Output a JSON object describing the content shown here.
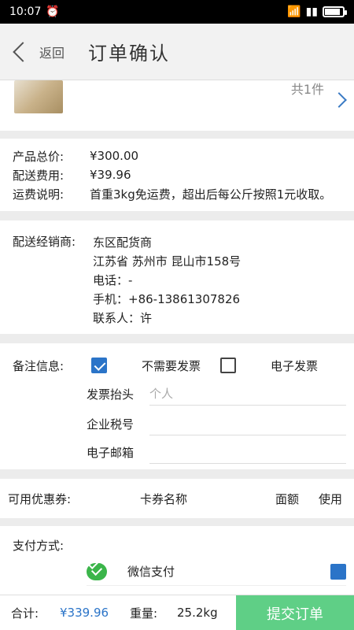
{
  "statusbar": {
    "time": "10:07"
  },
  "header": {
    "back_label": "返回",
    "title": "订单确认"
  },
  "product": {
    "count": "共1件"
  },
  "price": {
    "rows": [
      {
        "label": "产品总价:",
        "value": "¥300.00"
      },
      {
        "label": "配送费用:",
        "value": "¥39.96"
      },
      {
        "label": "运费说明:",
        "value": "首重3kg免运费，超出后每公斤按照1元收取。"
      }
    ]
  },
  "dealer": {
    "label": "配送经销商:",
    "lines": [
      "东区配货商",
      "江苏省 苏州市 昆山市158号",
      "电话：-",
      "手机：+86-13861307826",
      "联系人：许"
    ]
  },
  "remark": {
    "label": "备注信息:",
    "option1": "不需要发票",
    "option2": "电子发票",
    "invoice_title_label": "发票抬头",
    "invoice_title_placeholder": "个人",
    "tax_label": "企业税号",
    "email_label": "电子邮箱"
  },
  "coupon": {
    "label": "可用优惠券:",
    "col_name": "卡券名称",
    "col_amount": "面额",
    "col_use": "使用"
  },
  "payment": {
    "label": "支付方式:",
    "wechat": "微信支付"
  },
  "bottom": {
    "total_label": "合计:",
    "total": "¥339.96",
    "weight_label": "重量:",
    "weight": "25.2kg",
    "submit": "提交订单"
  },
  "colors": {
    "accent": "#2b74c8",
    "submit": "#5fcf86",
    "wechat": "#3bb54a"
  }
}
